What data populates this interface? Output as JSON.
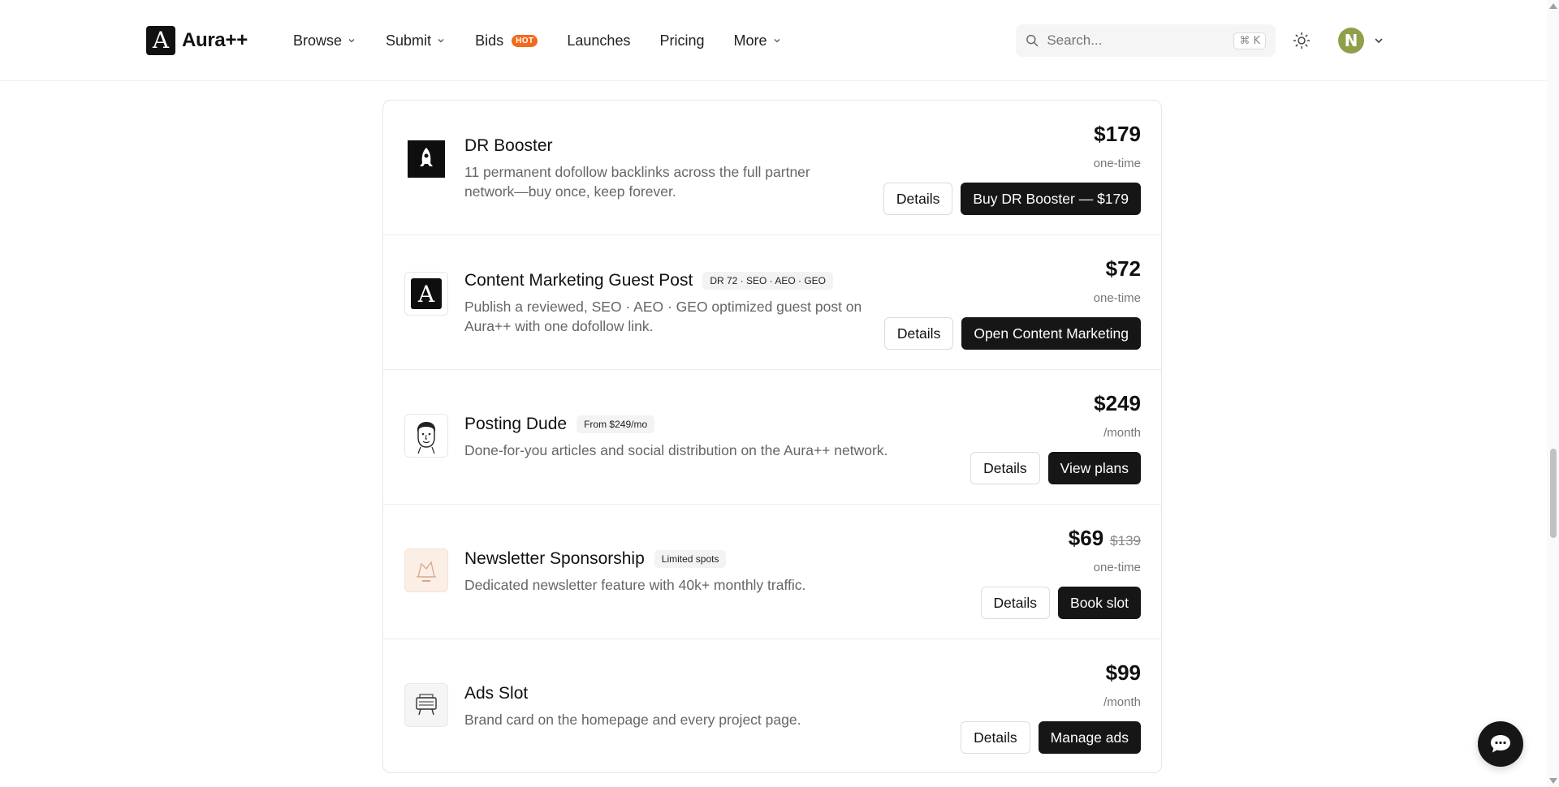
{
  "header": {
    "logo_text": "Aura++",
    "nav": [
      {
        "label": "Browse",
        "has_dropdown": true
      },
      {
        "label": "Submit",
        "has_dropdown": true
      },
      {
        "label": "Bids",
        "badge": "HOT"
      },
      {
        "label": "Launches"
      },
      {
        "label": "Pricing"
      },
      {
        "label": "More",
        "has_dropdown": true
      }
    ],
    "search": {
      "placeholder": "Search...",
      "shortcut": "⌘ K"
    },
    "avatar_initial": "N"
  },
  "products": [
    {
      "name": "DR Booster",
      "badge": "",
      "description": "11 permanent dofollow backlinks across the full partner network—buy once, keep forever.",
      "price": "$179",
      "original_price": "",
      "period": "one-time",
      "details_label": "Details",
      "cta_label": "Buy DR Booster — $179",
      "icon": "rocket-logo-icon"
    },
    {
      "name": "Content Marketing Guest Post",
      "badge": "DR 72 · SEO · AEO · GEO",
      "description": "Publish a reviewed, SEO · AEO · GEO optimized guest post on Aura++ with one dofollow link.",
      "price": "$72",
      "original_price": "",
      "period": "one-time",
      "details_label": "Details",
      "cta_label": "Open Content Marketing",
      "icon": "aura-logo-icon"
    },
    {
      "name": "Posting Dude",
      "badge": "From $249/mo",
      "description": "Done-for-you articles and social distribution on the Aura++ network.",
      "price": "$249",
      "original_price": "",
      "period": "/month",
      "details_label": "Details",
      "cta_label": "View plans",
      "icon": "face-illustration-icon"
    },
    {
      "name": "Newsletter Sponsorship",
      "badge": "Limited spots",
      "description": "Dedicated newsletter feature with 40k+ monthly traffic.",
      "price": "$69",
      "original_price": "$139",
      "period": "one-time",
      "details_label": "Details",
      "cta_label": "Book slot",
      "icon": "newsletter-illustration-icon"
    },
    {
      "name": "Ads Slot",
      "badge": "",
      "description": "Brand card on the homepage and every project page.",
      "price": "$99",
      "original_price": "",
      "period": "/month",
      "details_label": "Details",
      "cta_label": "Manage ads",
      "icon": "ad-board-icon"
    }
  ]
}
